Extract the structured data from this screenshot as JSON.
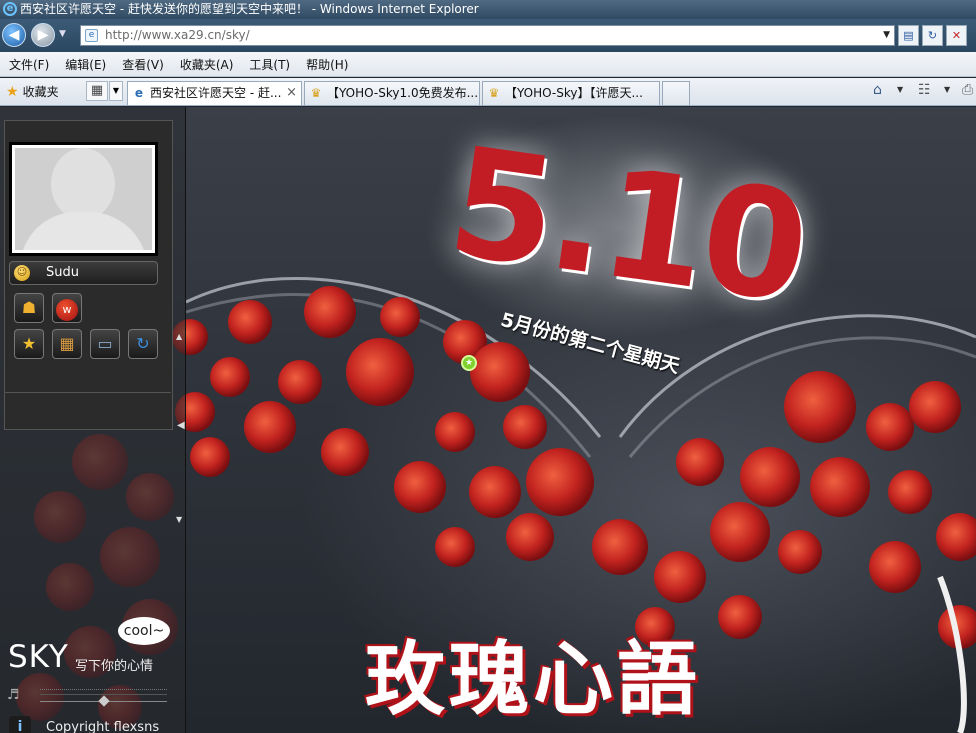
{
  "window": {
    "title": "西安社区许愿天空 - 赶快发送你的愿望到天空中来吧！ - Windows Internet Explorer"
  },
  "address_bar": {
    "url": "http://www.xa29.cn/sky/"
  },
  "menu": {
    "items": [
      "文件(F)",
      "编辑(E)",
      "查看(V)",
      "收藏夹(A)",
      "工具(T)",
      "帮助(H)"
    ]
  },
  "favorites": {
    "label": "收藏夹"
  },
  "tabs": [
    {
      "label": "西安社区许愿天空 - 赶...",
      "active": true
    },
    {
      "label": "【YOHO-Sky1.0免费发布..."
    },
    {
      "label": "【YOHO-Sky】【许愿天..."
    }
  ],
  "sidebar": {
    "username": "Sudu",
    "sky_title": "SKY",
    "sky_subtitle": "写下你的心情",
    "bubble_text": "cool~",
    "copyright": "Copyright flexsns",
    "volume_level": 0.5
  },
  "artwork": {
    "date_text": "5.10",
    "date_caption": "5月份的第二个星期天",
    "title_text": "玫瑰心語"
  },
  "icons": {
    "back": "back-arrow-icon",
    "forward": "forward-arrow-icon",
    "refresh": "refresh-icon",
    "stop": "stop-icon",
    "home": "home-icon",
    "feeds": "feeds-icon"
  },
  "colors": {
    "accent_red": "#c21d24",
    "browser_chrome": "#2f4a62"
  }
}
